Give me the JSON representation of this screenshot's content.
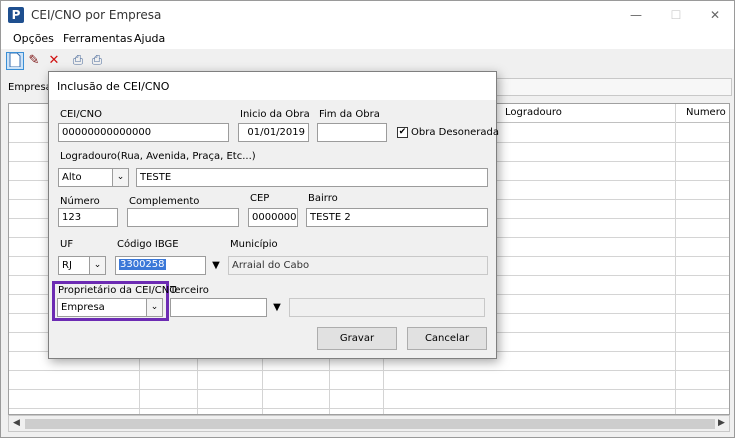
{
  "window": {
    "title": "CEI/CNO por Empresa",
    "icon_letter": "P",
    "minimize": "—",
    "maximize": "☐",
    "close": "✕"
  },
  "menu": {
    "items": [
      "Opções",
      "Ferramentas",
      "Ajuda"
    ]
  },
  "toolbar": {
    "icons": [
      "new-document-icon",
      "edit-icon",
      "delete-icon",
      "print-icon",
      "print-preview-icon"
    ]
  },
  "filter": {
    "empresa_label": "Empresa"
  },
  "grid": {
    "columns": [
      "Logradouro",
      "Numero"
    ]
  },
  "dialog": {
    "title": "Inclusão de CEI/CNO",
    "cei_cno": {
      "label": "CEI/CNO",
      "value": "00000000000000"
    },
    "inicio_obra": {
      "label": "Inicio da Obra",
      "value": "01/01/2019"
    },
    "fim_obra": {
      "label": "Fim da Obra",
      "value": ""
    },
    "obra_desonerada": {
      "label": "Obra Desonerada",
      "checked": "✔"
    },
    "logradouro": {
      "label": "Logradouro(Rua, Avenida, Praça, Etc...)",
      "tipo": "Alto",
      "value": "TESTE"
    },
    "numero": {
      "label": "Número",
      "value": "123"
    },
    "complemento": {
      "label": "Complemento",
      "value": ""
    },
    "cep": {
      "label": "CEP",
      "value": "00000000"
    },
    "bairro": {
      "label": "Bairro",
      "value": "TESTE 2"
    },
    "uf": {
      "label": "UF",
      "value": "RJ"
    },
    "codigo_ibge": {
      "label": "Código IBGE",
      "value": "3300258"
    },
    "municipio": {
      "label": "Município",
      "value": "Arraial do Cabo"
    },
    "proprietario": {
      "label": "Proprietário da CEI/CNO",
      "value": "Empresa"
    },
    "terceiro": {
      "label": "Terceiro",
      "value": "",
      "name": ""
    },
    "gravar_label": "Gravar",
    "cancelar_label": "Cancelar"
  },
  "colors": {
    "highlight": "#6c2bb3",
    "selection": "#3b78d8"
  }
}
